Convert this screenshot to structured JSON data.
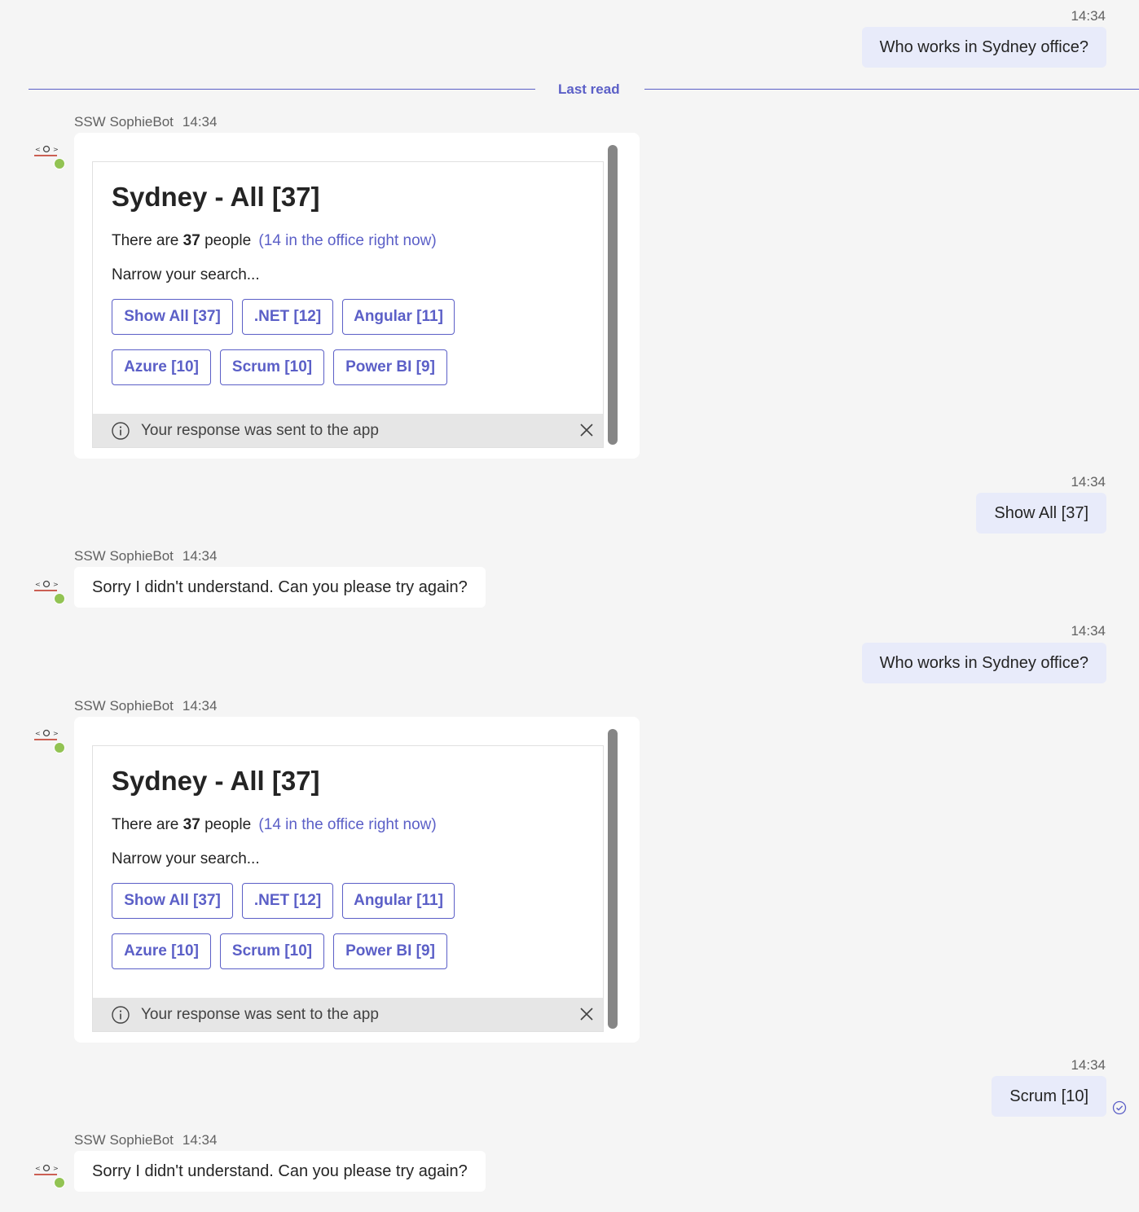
{
  "colors": {
    "accent": "#5b5fc7",
    "my_bubble": "#e8ebfa",
    "background": "#f5f5f5",
    "presence": "#92c353"
  },
  "divider": {
    "label": "Last read"
  },
  "messages": [
    {
      "timestamp": "14:34",
      "text": "Who works in Sydney office?"
    },
    {
      "sender": "SSW SophieBot",
      "timestamp": "14:34"
    },
    {
      "timestamp": "14:34",
      "text": "Show All [37]"
    },
    {
      "sender": "SSW SophieBot",
      "timestamp": "14:34",
      "text": "Sorry I didn't understand. Can you please try again?"
    },
    {
      "timestamp": "14:34",
      "text": "Who works in Sydney office?"
    },
    {
      "sender": "SSW SophieBot",
      "timestamp": "14:34"
    },
    {
      "timestamp": "14:34",
      "text": "Scrum [10]"
    },
    {
      "sender": "SSW SophieBot",
      "timestamp": "14:34",
      "text": "Sorry I didn't understand. Can you please try again?"
    }
  ],
  "card": {
    "title": "Sydney - All [37]",
    "summary_prefix": "There are",
    "summary_count": "37",
    "summary_suffix": "people",
    "summary_link": "(14 in the office right now)",
    "narrow_label": "Narrow your search...",
    "buttons": [
      "Show All [37]",
      ".NET [12]",
      "Angular [11]",
      "Azure [10]",
      "Scrum [10]",
      "Power BI [9]"
    ],
    "footer_text": "Your response was sent to the app"
  },
  "icons": {
    "avatar": "sophiebot-avatar-icon",
    "info": "info-icon",
    "close": "close-icon",
    "sent": "sent-check-icon"
  }
}
